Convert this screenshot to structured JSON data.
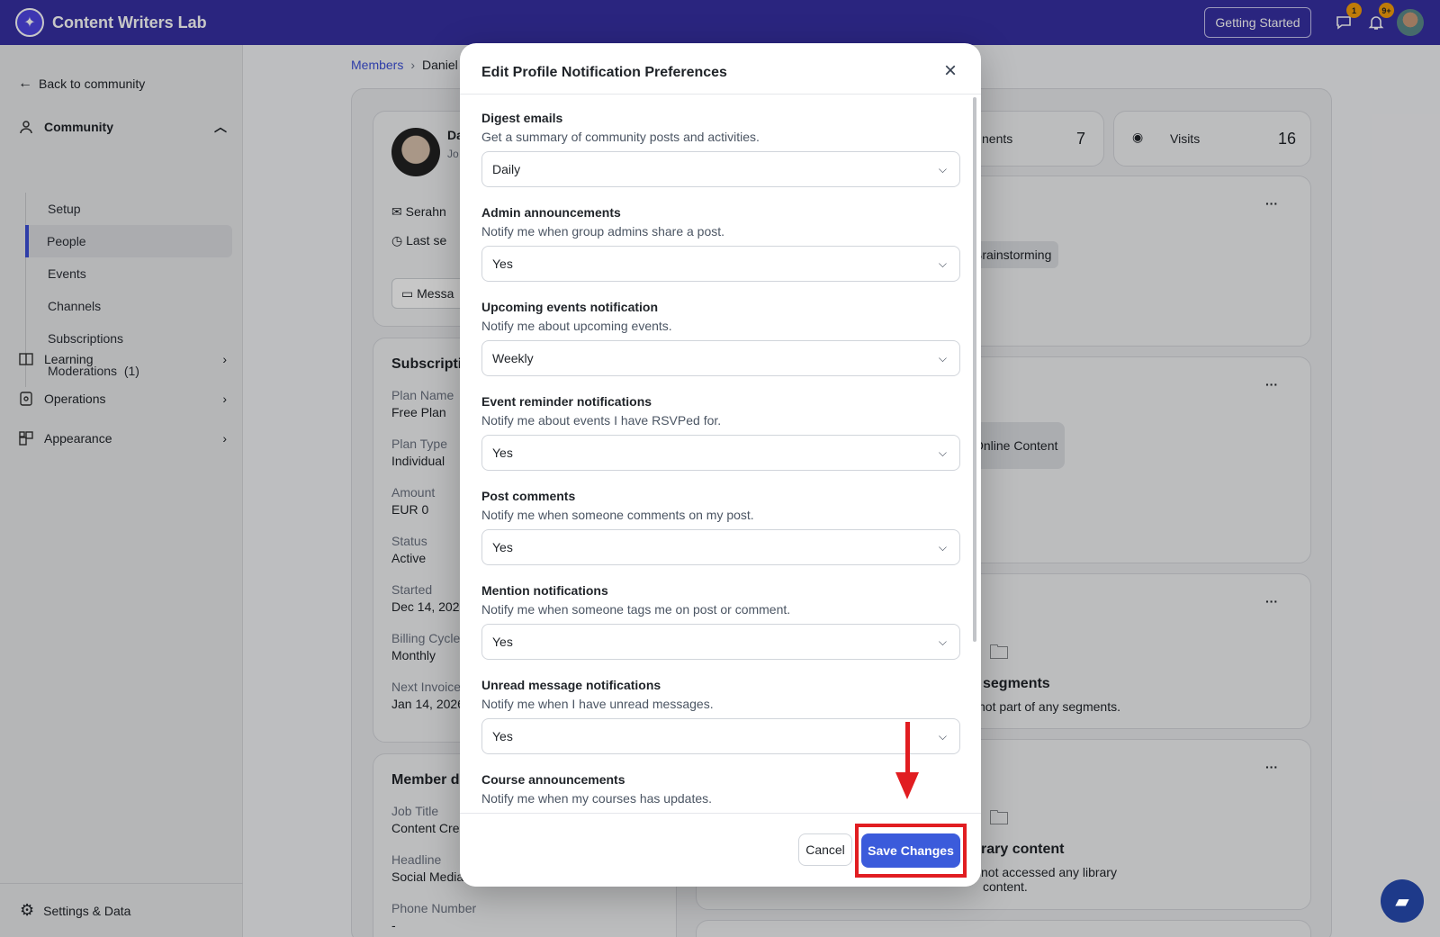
{
  "app": {
    "title": "Content Writers Lab"
  },
  "topbar": {
    "getting_started": "Getting Started",
    "chat_badge": "1",
    "bell_badge": "9+"
  },
  "sidebar": {
    "back": "Back to community",
    "community": "Community",
    "items": [
      {
        "label": "Setup"
      },
      {
        "label": "People"
      },
      {
        "label": "Events"
      },
      {
        "label": "Channels"
      },
      {
        "label": "Subscriptions"
      },
      {
        "label": "Moderations  (1)"
      }
    ],
    "learning": "Learning",
    "operations": "Operations",
    "appearance": "Appearance",
    "settings": "Settings & Data"
  },
  "breadcrumb": {
    "members": "Members",
    "current": "Daniel"
  },
  "background": {
    "stats": {
      "comments_label": "nents",
      "comments_value": "7",
      "visits_label": "Visits",
      "visits_value": "16"
    },
    "tag1": "Brainstorming",
    "tag2": "Online Content",
    "segments_title": "segments",
    "segments_desc": "not part of any segments.",
    "library_title": "rary content",
    "library_desc1": "not accessed any library",
    "library_desc2": "content.",
    "profile": {
      "name": "Da",
      "sub": "Jo",
      "email": "Serahn",
      "last_seen": "Last se",
      "message": "Messa"
    },
    "subscription": {
      "title": "Subscripti",
      "rows": [
        {
          "label": "Plan Name",
          "value": "Free Plan"
        },
        {
          "label": "Plan Type",
          "value": "Individual"
        },
        {
          "label": "Amount",
          "value": "EUR 0"
        },
        {
          "label": "Status",
          "value": "Active"
        },
        {
          "label": "Started",
          "value": "Dec 14, 2025"
        },
        {
          "label": "Billing Cycle",
          "value": "Monthly"
        },
        {
          "label": "Next Invoice",
          "value": "Jan 14, 2026"
        }
      ]
    },
    "member": {
      "title": "Member de",
      "rows": [
        {
          "label": "Job Title",
          "value": "Content Cre"
        },
        {
          "label": "Headline",
          "value": "Social Media"
        },
        {
          "label": "Phone Number",
          "value": "-"
        }
      ]
    }
  },
  "modal": {
    "title": "Edit Profile Notification Preferences",
    "prefs": [
      {
        "title": "Digest emails",
        "desc": "Get a summary of community posts and activities.",
        "value": "Daily"
      },
      {
        "title": "Admin announcements",
        "desc": "Notify me when group admins share a post.",
        "value": "Yes"
      },
      {
        "title": "Upcoming events notification",
        "desc": "Notify me about upcoming events.",
        "value": "Weekly"
      },
      {
        "title": "Event reminder notifications",
        "desc": "Notify me about events I have RSVPed for.",
        "value": "Yes"
      },
      {
        "title": "Post comments",
        "desc": "Notify me when someone comments on my post.",
        "value": "Yes"
      },
      {
        "title": "Mention notifications",
        "desc": "Notify me when someone tags me on post or comment.",
        "value": "Yes"
      },
      {
        "title": "Unread message notifications",
        "desc": "Notify me when I have unread messages.",
        "value": "Yes"
      },
      {
        "title": "Course announcements",
        "desc": "Notify me when my courses has updates.",
        "value": ""
      }
    ],
    "cancel": "Cancel",
    "save": "Save Changes"
  },
  "colors": {
    "topbar": "#3730a3",
    "primary": "#3b5bdb",
    "annotation": "#e11d21"
  }
}
